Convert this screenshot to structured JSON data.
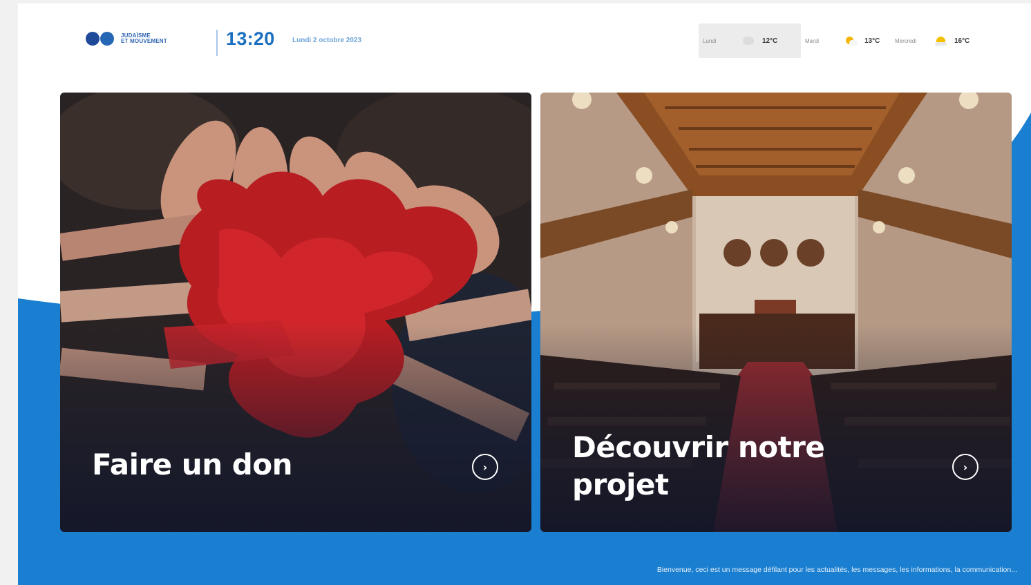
{
  "header": {
    "brand_lines": [
      "JUDAÏSME",
      "ET MOUVEMENT"
    ],
    "time": "13:20",
    "date": "Lundi 2 octobre 2023"
  },
  "weather": [
    {
      "day": "Lundi",
      "icon": "cloud-icon",
      "temp": "12°C",
      "active": true
    },
    {
      "day": "Mardi",
      "icon": "partly-sunny-icon",
      "temp": "13°C",
      "active": false
    },
    {
      "day": "Mercredi",
      "icon": "sunset-icon",
      "temp": "16°C",
      "active": false
    }
  ],
  "cards": [
    {
      "title": "Faire un don",
      "image": "painted-hands-heart",
      "icon": "chevron-right-icon"
    },
    {
      "title": "Découvrir notre projet",
      "image": "synagogue-interior",
      "icon": "chevron-right-icon"
    }
  ],
  "ticker": "Bienvenue, ceci est un message défilant pour les actualités, les messages, les informations, la communication...",
  "colors": {
    "accent_blue": "#1a7fd0",
    "clock_blue": "#1a6fc0",
    "logo_navy": "#1f4a9a",
    "white": "#ffffff"
  }
}
